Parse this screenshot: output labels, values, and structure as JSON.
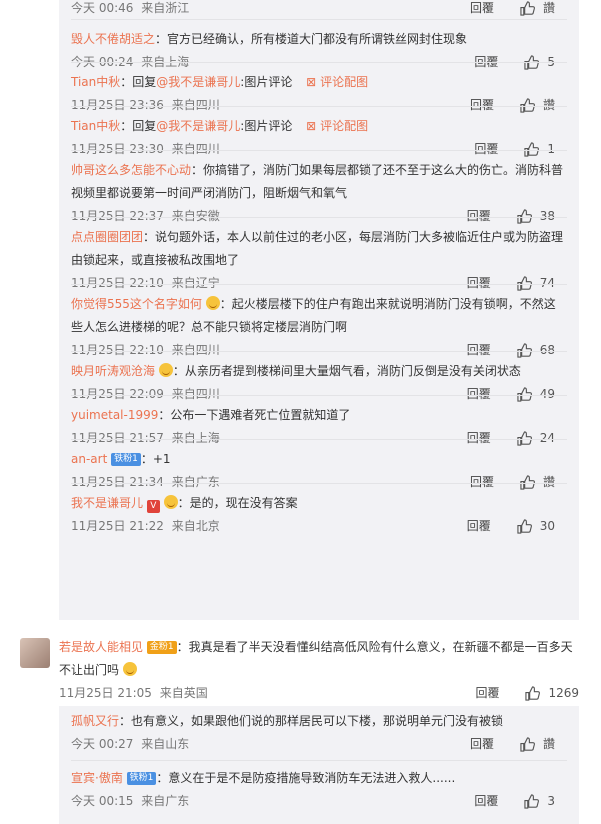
{
  "labels": {
    "reply": "回覆",
    "like_zero": "讚",
    "image_comment": "图片评论",
    "comment_image": "评论配图",
    "reply_prefix": "回复"
  },
  "replies_group_1": [
    {
      "author": "",
      "text": "",
      "time": "今天 00:46",
      "loc": "来自浙江",
      "likes": "讚"
    },
    {
      "author": "毁人不倦胡适之",
      "text": "：官方已经确认，所有楼道大门都没有所谓铁丝网封住现象",
      "time": "今天 00:24",
      "loc": "来自上海",
      "likes": "5"
    },
    {
      "author": "Tian中秋",
      "text": "：回复",
      "mention": "@我不是谦哥儿",
      "suffix": ":图片评论",
      "pic": "评论配图",
      "time": "11月25日 23:36",
      "loc": "来自四川",
      "likes": "讚"
    },
    {
      "author": "Tian中秋",
      "text": "：回复",
      "mention": "@我不是谦哥儿",
      "suffix": ":图片评论",
      "pic": "评论配图",
      "time": "11月25日 23:30",
      "loc": "来自四川",
      "likes": "1"
    },
    {
      "author": "帅哥这么多怎能不心动",
      "text": "：你搞错了，消防门如果每层都锁了还不至于这么大的伤亡。消防科普视频里都说要第一时间严闭消防门，阻断烟气和氧气",
      "time": "11月25日 22:37",
      "loc": "来自安徽",
      "likes": "38"
    },
    {
      "author": "点点圈圈团团",
      "text": "：说句题外话，本人以前住过的老小区，每层消防门大多被临近住户或为防盗理由锁起来，或直接被私改围地了",
      "time": "11月25日 22:10",
      "loc": "来自辽宁",
      "likes": "74"
    },
    {
      "author": "你觉得555这个名字如何",
      "text": "：起火楼层楼下的住户有跑出来就说明消防门没有锁啊，不然这些人怎么进楼梯的呢？总不能只锁将定楼层消防门啊",
      "time": "11月25日 22:10",
      "loc": "来自四川",
      "likes": "68"
    },
    {
      "author": "映月听涛观沧海",
      "text": "：从亲历者提到楼梯间里大量烟气看，消防门反倒是没有关闭状态",
      "time": "11月25日 22:09",
      "loc": "来自四川",
      "likes": "49"
    },
    {
      "author": "yuimetal-1999",
      "text": "：公布一下遇难者死亡位置就知道了",
      "time": "11月25日 21:57",
      "loc": "来自上海",
      "likes": "24"
    },
    {
      "author": "an-art",
      "badge": "铁粉1",
      "text": "：+1",
      "time": "11月25日 21:34",
      "loc": "来自广东",
      "likes": "讚"
    },
    {
      "author": "我不是谦哥儿",
      "text": "：是的，现在没有答案",
      "time": "11月25日 21:22",
      "loc": "来自北京",
      "likes": "30"
    }
  ],
  "top_comment": {
    "author": "若是故人能相见",
    "badge": "金粉1",
    "text": "：我真是看了半天没看懂纠结高低风险有什么意义，在新疆不都是一百多天不让出门吗",
    "time": "11月25日 21:05",
    "loc": "来自英国",
    "likes": "1269"
  },
  "replies_group_2": [
    {
      "author": "孤帆又行",
      "text": "：也有意义，如果跟他们说的那样居民可以下楼，那说明单元门没有被锁",
      "time": "今天 00:27",
      "loc": "来自山东",
      "likes": "讚"
    },
    {
      "author": "宣宾·傲南",
      "badge": "铁粉1",
      "text": "：意义在于是不是防疫措施导致消防车无法进入救人......",
      "time": "今天 00:15",
      "loc": "来自广东",
      "likes": "3"
    }
  ]
}
